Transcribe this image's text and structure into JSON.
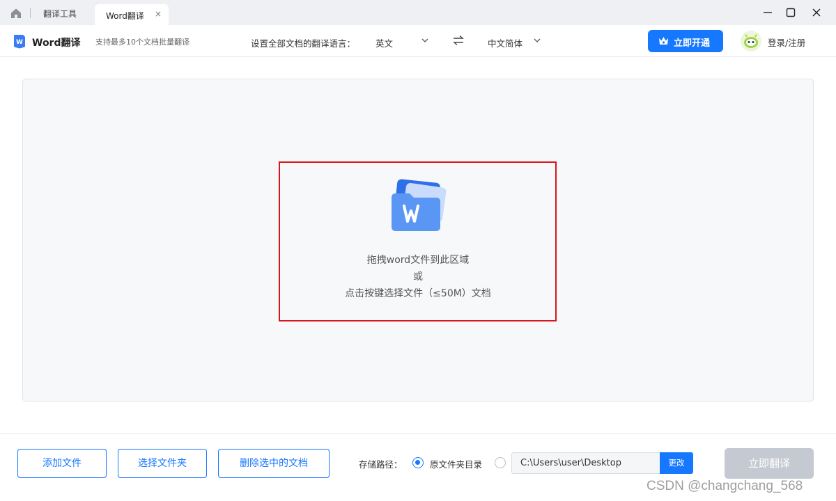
{
  "titlebar": {
    "tabs": [
      {
        "label": "翻译工具",
        "active": false
      },
      {
        "label": "Word翻译",
        "active": true,
        "close": "×"
      }
    ],
    "icons": [
      "home-icon",
      "minimize-icon",
      "maximize-icon",
      "close-icon"
    ]
  },
  "toolbar": {
    "app_name": "Word翻译",
    "app_subtitle": "支持最多10个文档批量翻译",
    "language_label": "设置全部文档的翻译语言：",
    "source_language": "英文",
    "target_language": "中文简体",
    "vip_button": "立即开通",
    "login_link": "登录/注册"
  },
  "dropzone": {
    "line1": "拖拽word文件到此区域",
    "line2": "或",
    "line3": "点击按键选择文件（≤50M）文档"
  },
  "footer": {
    "add_file": "添加文件",
    "select_folder": "选择文件夹",
    "delete_selected": "删除选中的文档",
    "save_path_label": "存储路径：",
    "original_folder_option": "原文件夹目录",
    "custom_path": "C:\\Users\\user\\Desktop",
    "change_button": "更改",
    "translate_button": "立即翻译"
  },
  "watermark": "CSDN @changchang_568",
  "colors": {
    "accent": "#1677ff",
    "highlight_border": "#d9141a",
    "disabled_button": "#c5cad2",
    "panel_bg": "#f7f8fa"
  }
}
